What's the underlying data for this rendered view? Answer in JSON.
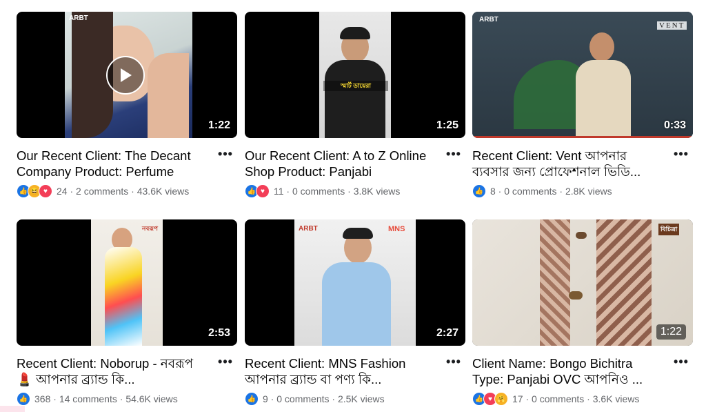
{
  "more_label": "•••",
  "videos": [
    {
      "duration": "1:22",
      "title": "Our Recent Client: The Decant Company Product: Perfume",
      "reaction_count": "24",
      "comments": "2 comments",
      "views": "43.6K views",
      "reactions": [
        "like-icon",
        "haha-icon",
        "love-icon"
      ]
    },
    {
      "duration": "1:25",
      "title": "Our Recent Client: A to Z Online Shop Product: Panjabi",
      "reaction_count": "11",
      "comments": "0 comments",
      "views": "3.8K views",
      "reactions": [
        "like-icon",
        "love-icon"
      ],
      "overlay_text": "স্মার্ট ডায়েরা"
    },
    {
      "duration": "0:33",
      "title": "Recent Client: Vent আপনার ব্যবসার জন্য প্রোফেশনাল ভিডি...",
      "reaction_count": "8",
      "comments": "0 comments",
      "views": "2.8K views",
      "reactions": [
        "like-icon"
      ],
      "brand": "VENT"
    },
    {
      "duration": "2:53",
      "title": "Recent Client: Noborup - নবরূপ 💄 আপনার ব্র্যান্ড কি...",
      "reaction_count": "368",
      "comments": "14 comments",
      "views": "54.6K views",
      "reactions": [
        "like-icon"
      ]
    },
    {
      "duration": "2:27",
      "title": "Recent Client: MNS Fashion আপনার ব্র্যান্ড বা পণ্য কি...",
      "reaction_count": "9",
      "comments": "0 comments",
      "views": "2.5K views",
      "reactions": [
        "like-icon"
      ],
      "brand": "MNS"
    },
    {
      "duration": "1:22",
      "title": "Client Name: Bongo Bichitra Type: Panjabi OVC আপনিও ...",
      "reaction_count": "17",
      "comments": "0 comments",
      "views": "3.6K views",
      "reactions": [
        "like-icon",
        "love-icon",
        "care-icon"
      ]
    }
  ]
}
